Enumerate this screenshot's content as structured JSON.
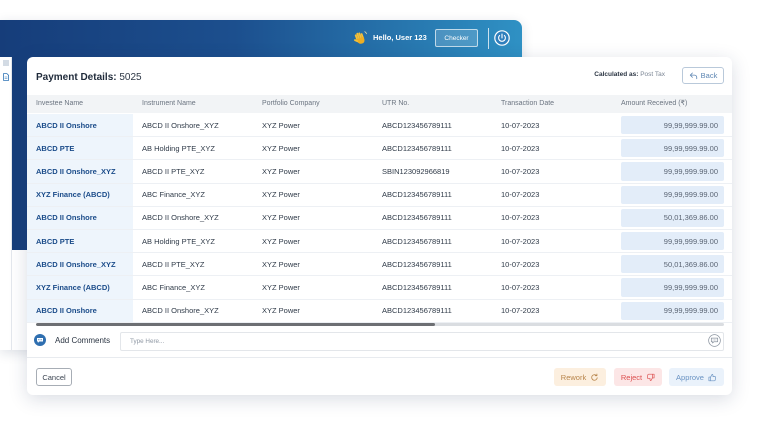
{
  "background_app": {
    "greeting": "Hello, User 123",
    "role_button_label": "Checker",
    "icons": {
      "menu": "menu-icon",
      "document": "document-icon",
      "greeting": "waving-hand-icon",
      "power": "power-icon"
    },
    "colors": {
      "header_gradient_start": "#163d7a",
      "header_gradient_mid": "#1c4f8e",
      "header_gradient_end": "#2f91c4"
    }
  },
  "payment_details": {
    "title_label": "Payment Details:",
    "title_value": "5025",
    "calculated_as_label": "Calculated as:",
    "calculated_as_value": "Post Tax",
    "back_label": "Back",
    "back_icon": "back-arrow-icon",
    "table": {
      "columns": {
        "investee": "Investee Name",
        "instrument": "Instrument Name",
        "company": "Portfolio Company",
        "utr": "UTR No.",
        "date": "Transaction Date",
        "amount": "Amount Received (₹)"
      },
      "rows": [
        {
          "investee": "ABCD II Onshore",
          "instrument": "ABCD II Onshore_XYZ",
          "company": "XYZ Power",
          "utr": "ABCD123456789111",
          "date": "10-07-2023",
          "amount": "99,99,999.99.00"
        },
        {
          "investee": "ABCD PTE",
          "instrument": "AB Holding PTE_XYZ",
          "company": "XYZ Power",
          "utr": "ABCD123456789111",
          "date": "10-07-2023",
          "amount": "99,99,999.99.00"
        },
        {
          "investee": "ABCD II Onshore_XYZ",
          "instrument": "ABCD II PTE_XYZ",
          "company": "XYZ Power",
          "utr": "SBIN123092966819",
          "date": "10-07-2023",
          "amount": "99,99,999.99.00"
        },
        {
          "investee": "XYZ Finance (ABCD)",
          "instrument": "ABC Finance_XYZ",
          "company": "XYZ Power",
          "utr": "ABCD123456789111",
          "date": "10-07-2023",
          "amount": "99,99,999.99.00"
        },
        {
          "investee": "ABCD II Onshore",
          "instrument": "ABCD II Onshore_XYZ",
          "company": "XYZ Power",
          "utr": "ABCD123456789111",
          "date": "10-07-2023",
          "amount": "50,01,369.86.00"
        },
        {
          "investee": "ABCD PTE",
          "instrument": "AB Holding PTE_XYZ",
          "company": "XYZ Power",
          "utr": "ABCD123456789111",
          "date": "10-07-2023",
          "amount": "99,99,999.99.00"
        },
        {
          "investee": "ABCD II Onshore_XYZ",
          "instrument": "ABCD II PTE_XYZ",
          "company": "XYZ Power",
          "utr": "ABCD123456789111",
          "date": "10-07-2023",
          "amount": "50,01,369.86.00"
        },
        {
          "investee": "XYZ Finance (ABCD)",
          "instrument": "ABC Finance_XYZ",
          "company": "XYZ Power",
          "utr": "ABCD123456789111",
          "date": "10-07-2023",
          "amount": "99,99,999.99.00"
        },
        {
          "investee": "ABCD II Onshore",
          "instrument": "ABCD II Onshore_XYZ",
          "company": "XYZ Power",
          "utr": "ABCD123456789111",
          "date": "10-07-2023",
          "amount": "99,99,999.99.00"
        }
      ],
      "horizontal_scroll": {
        "visible_fraction": 0.58
      }
    },
    "comments": {
      "label": "Add Comments",
      "placeholder": "Type Here...",
      "icon": "comment-icon",
      "input_icon": "chat-bubbles-icon"
    },
    "actions": {
      "cancel": "Cancel",
      "rework": "Rework",
      "reject": "Reject",
      "approve": "Approve",
      "rework_icon": "refresh-icon",
      "reject_icon": "thumbs-down-icon",
      "approve_icon": "thumbs-up-icon"
    },
    "colors": {
      "investee_link": "#1b4c8a",
      "rework": "#b8854b",
      "reject": "#dc4f4f",
      "approve": "#6a93c3"
    }
  }
}
